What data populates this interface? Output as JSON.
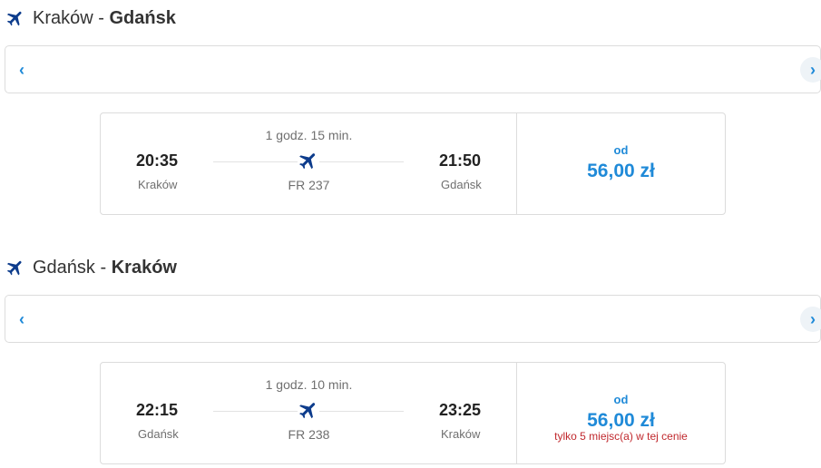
{
  "outbound": {
    "route": {
      "from": "Kraków",
      "separator": " - ",
      "to": "Gdańsk"
    },
    "nav": {
      "prev": "‹",
      "next": "›"
    },
    "flight": {
      "duration": "1 godz. 15 min.",
      "dep_time": "20:35",
      "dep_city": "Kraków",
      "arr_time": "21:50",
      "arr_city": "Gdańsk",
      "flight_number": "FR 237",
      "price_prefix": "od",
      "price": "56,00 zł",
      "seats_note": ""
    }
  },
  "return": {
    "route": {
      "from": "Gdańsk",
      "separator": " - ",
      "to": "Kraków"
    },
    "nav": {
      "prev": "‹",
      "next": "›"
    },
    "flight": {
      "duration": "1 godz. 10 min.",
      "dep_time": "22:15",
      "dep_city": "Gdańsk",
      "arr_time": "23:25",
      "arr_city": "Kraków",
      "flight_number": "FR 238",
      "price_prefix": "od",
      "price": "56,00 zł",
      "seats_note": "tylko 5 miejsc(a) w tej cenie"
    }
  },
  "colors": {
    "accent": "#1f8ad8",
    "plane": "#0d3c8c",
    "warning": "#c0282d"
  },
  "icons": {
    "title": "airplane-icon",
    "card": "airplane-icon"
  }
}
